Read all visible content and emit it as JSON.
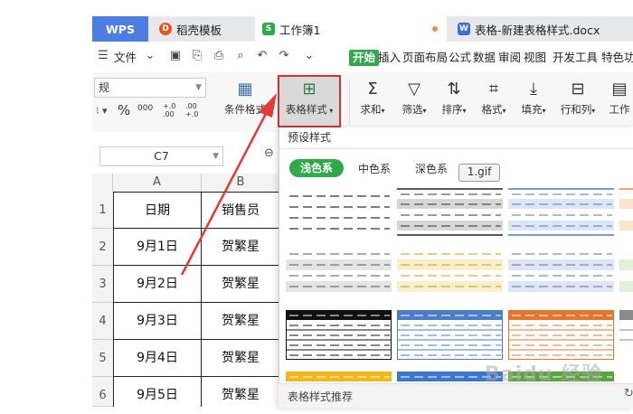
{
  "tabs": {
    "wps": "WPS",
    "template": "稻壳模板",
    "workbook": "工作簿1",
    "document": "表格-新建表格样式.docx"
  },
  "menu": {
    "file": "文件",
    "items": [
      "开始",
      "插入",
      "页面布局",
      "公式",
      "数据",
      "审阅",
      "视图",
      "开发工具",
      "特色功"
    ]
  },
  "ribbon": {
    "number_format": "规",
    "percent": "%",
    "thousands": "000",
    "inc_decimal": "+.0 .00",
    "dec_decimal": ".00 +.0",
    "conditional_format": "条件格式",
    "table_style": "表格样式",
    "sum": "求和",
    "filter": "筛选",
    "sort": "排序",
    "format": "格式",
    "fill": "填充",
    "row_col": "行和列",
    "worksheet": "工作"
  },
  "namebox": "C7",
  "sheet": {
    "columns": [
      "A",
      "B"
    ],
    "rows": [
      {
        "num": "1",
        "a": "日期",
        "b": "销售员"
      },
      {
        "num": "2",
        "a": "9月1日",
        "b": "贺繁星"
      },
      {
        "num": "3",
        "a": "9月2日",
        "b": "贺繁星"
      },
      {
        "num": "4",
        "a": "9月3日",
        "b": "贺繁星"
      },
      {
        "num": "5",
        "a": "9月4日",
        "b": "贺繁星"
      },
      {
        "num": "6",
        "a": "9月5日",
        "b": "贺繁星"
      }
    ]
  },
  "panel": {
    "title": "预设样式",
    "filters": [
      "浅色系",
      "中色系",
      "深色系"
    ],
    "tooltip": "1.gif",
    "footer": "表格样式推荐"
  },
  "watermark": "Baidu 经验",
  "colors": {
    "accent_green": "#2fa94a",
    "highlight_red": "#d9302e",
    "wps_blue": "#4b7ee0"
  }
}
